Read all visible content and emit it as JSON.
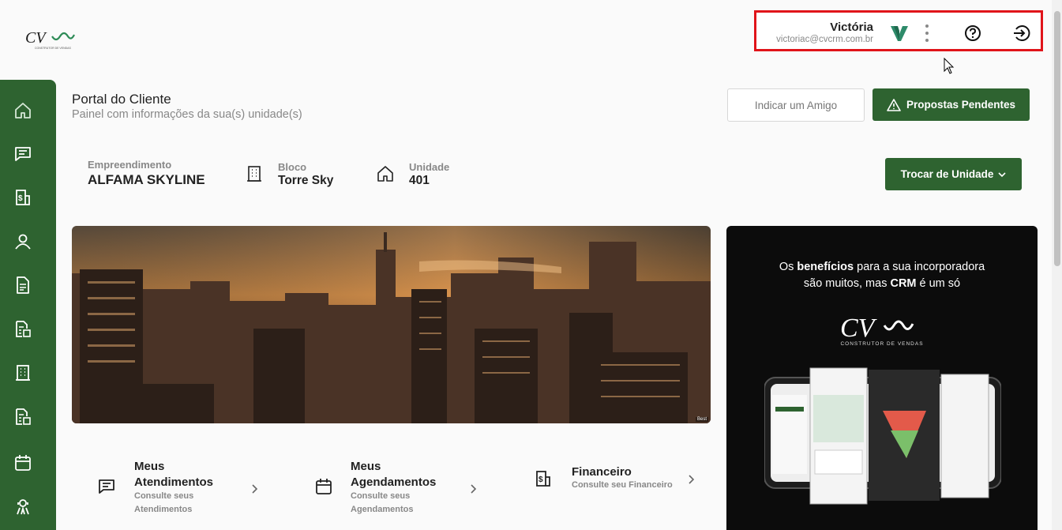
{
  "brand": {
    "logo_text": "CV",
    "logo_sub": "CONSTRUTOR DE VENDAS",
    "accent": "#2e6330",
    "highlight_border": "#e0141a"
  },
  "user": {
    "name": "Victória",
    "email": "victoriac@cvcrm.com.br",
    "avatar_icon": "v-logo-icon",
    "menu_icon": "more-vertical-icon",
    "help_icon": "help-circle-icon",
    "logout_icon": "logout-icon"
  },
  "sidebar": {
    "items": [
      {
        "icon": "home-icon"
      },
      {
        "icon": "chat-icon"
      },
      {
        "icon": "finance-icon"
      },
      {
        "icon": "user-icon"
      },
      {
        "icon": "document-icon"
      },
      {
        "icon": "document-building-icon"
      },
      {
        "icon": "building-icon"
      },
      {
        "icon": "document-building-icon"
      },
      {
        "icon": "calendar-icon"
      },
      {
        "icon": "support-icon"
      }
    ]
  },
  "header": {
    "title": "Portal do Cliente",
    "subtitle": "Painel com informações da sua(s) unidade(s)",
    "indicate_button": "Indicar um Amigo",
    "proposals_button": "Propostas Pendentes"
  },
  "unit": {
    "development_label": "Empreendimento",
    "development_value": "ALFAMA SKYLINE",
    "block_label": "Bloco",
    "block_value": "Torre Sky",
    "unit_label": "Unidade",
    "unit_value": "401",
    "switch_button": "Trocar de Unidade"
  },
  "hero": {
    "credit": "Best"
  },
  "ad": {
    "line1_prefix": "Os ",
    "line1_bold": "benefícios",
    "line1_suffix": " para a sua incorporadora",
    "line2_prefix": "são muitos, mas ",
    "line2_bold": "CRM",
    "line2_suffix": " é um só",
    "logo_text": "CV",
    "logo_sub": "CONSTRUTOR DE VENDAS"
  },
  "quick_links": [
    {
      "title_line1": "Meus",
      "title_line2": "Atendimentos",
      "desc_line1": "Consulte seus",
      "desc_line2": "Atendimentos",
      "icon": "chat-icon"
    },
    {
      "title_line1": "Meus",
      "title_line2": "Agendamentos",
      "desc_line1": "Consulte seus",
      "desc_line2": "Agendamentos",
      "icon": "calendar-icon"
    },
    {
      "title_line1": "Financeiro",
      "title_line2": "",
      "desc_line1": "Consulte seu Financeiro",
      "desc_line2": "",
      "icon": "finance-icon"
    }
  ]
}
